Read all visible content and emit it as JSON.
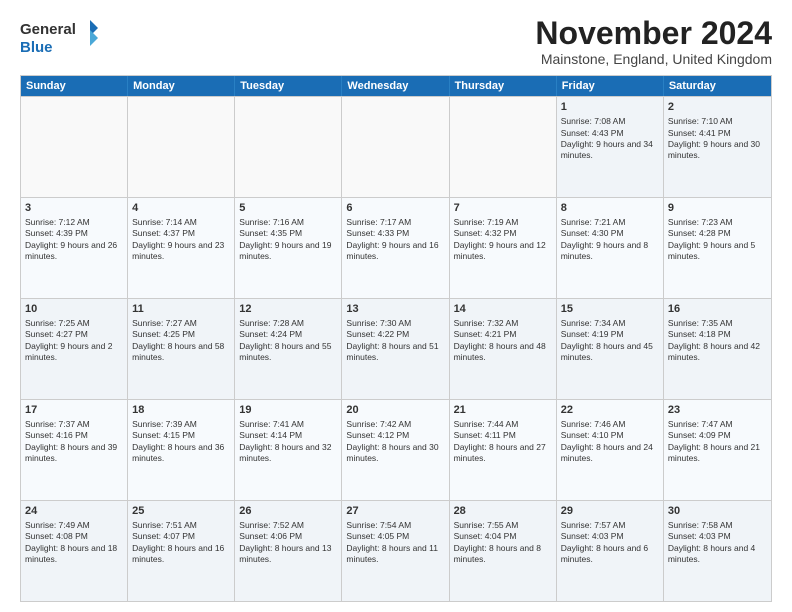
{
  "logo": {
    "line1": "General",
    "line2": "Blue"
  },
  "title": "November 2024",
  "subtitle": "Mainstone, England, United Kingdom",
  "days": [
    "Sunday",
    "Monday",
    "Tuesday",
    "Wednesday",
    "Thursday",
    "Friday",
    "Saturday"
  ],
  "rows": [
    [
      {
        "day": "",
        "empty": true
      },
      {
        "day": "",
        "empty": true
      },
      {
        "day": "",
        "empty": true
      },
      {
        "day": "",
        "empty": true
      },
      {
        "day": "",
        "empty": true
      },
      {
        "day": "1",
        "sunrise": "Sunrise: 7:08 AM",
        "sunset": "Sunset: 4:43 PM",
        "daylight": "Daylight: 9 hours and 34 minutes."
      },
      {
        "day": "2",
        "sunrise": "Sunrise: 7:10 AM",
        "sunset": "Sunset: 4:41 PM",
        "daylight": "Daylight: 9 hours and 30 minutes."
      }
    ],
    [
      {
        "day": "3",
        "sunrise": "Sunrise: 7:12 AM",
        "sunset": "Sunset: 4:39 PM",
        "daylight": "Daylight: 9 hours and 26 minutes."
      },
      {
        "day": "4",
        "sunrise": "Sunrise: 7:14 AM",
        "sunset": "Sunset: 4:37 PM",
        "daylight": "Daylight: 9 hours and 23 minutes."
      },
      {
        "day": "5",
        "sunrise": "Sunrise: 7:16 AM",
        "sunset": "Sunset: 4:35 PM",
        "daylight": "Daylight: 9 hours and 19 minutes."
      },
      {
        "day": "6",
        "sunrise": "Sunrise: 7:17 AM",
        "sunset": "Sunset: 4:33 PM",
        "daylight": "Daylight: 9 hours and 16 minutes."
      },
      {
        "day": "7",
        "sunrise": "Sunrise: 7:19 AM",
        "sunset": "Sunset: 4:32 PM",
        "daylight": "Daylight: 9 hours and 12 minutes."
      },
      {
        "day": "8",
        "sunrise": "Sunrise: 7:21 AM",
        "sunset": "Sunset: 4:30 PM",
        "daylight": "Daylight: 9 hours and 8 minutes."
      },
      {
        "day": "9",
        "sunrise": "Sunrise: 7:23 AM",
        "sunset": "Sunset: 4:28 PM",
        "daylight": "Daylight: 9 hours and 5 minutes."
      }
    ],
    [
      {
        "day": "10",
        "sunrise": "Sunrise: 7:25 AM",
        "sunset": "Sunset: 4:27 PM",
        "daylight": "Daylight: 9 hours and 2 minutes."
      },
      {
        "day": "11",
        "sunrise": "Sunrise: 7:27 AM",
        "sunset": "Sunset: 4:25 PM",
        "daylight": "Daylight: 8 hours and 58 minutes."
      },
      {
        "day": "12",
        "sunrise": "Sunrise: 7:28 AM",
        "sunset": "Sunset: 4:24 PM",
        "daylight": "Daylight: 8 hours and 55 minutes."
      },
      {
        "day": "13",
        "sunrise": "Sunrise: 7:30 AM",
        "sunset": "Sunset: 4:22 PM",
        "daylight": "Daylight: 8 hours and 51 minutes."
      },
      {
        "day": "14",
        "sunrise": "Sunrise: 7:32 AM",
        "sunset": "Sunset: 4:21 PM",
        "daylight": "Daylight: 8 hours and 48 minutes."
      },
      {
        "day": "15",
        "sunrise": "Sunrise: 7:34 AM",
        "sunset": "Sunset: 4:19 PM",
        "daylight": "Daylight: 8 hours and 45 minutes."
      },
      {
        "day": "16",
        "sunrise": "Sunrise: 7:35 AM",
        "sunset": "Sunset: 4:18 PM",
        "daylight": "Daylight: 8 hours and 42 minutes."
      }
    ],
    [
      {
        "day": "17",
        "sunrise": "Sunrise: 7:37 AM",
        "sunset": "Sunset: 4:16 PM",
        "daylight": "Daylight: 8 hours and 39 minutes."
      },
      {
        "day": "18",
        "sunrise": "Sunrise: 7:39 AM",
        "sunset": "Sunset: 4:15 PM",
        "daylight": "Daylight: 8 hours and 36 minutes."
      },
      {
        "day": "19",
        "sunrise": "Sunrise: 7:41 AM",
        "sunset": "Sunset: 4:14 PM",
        "daylight": "Daylight: 8 hours and 32 minutes."
      },
      {
        "day": "20",
        "sunrise": "Sunrise: 7:42 AM",
        "sunset": "Sunset: 4:12 PM",
        "daylight": "Daylight: 8 hours and 30 minutes."
      },
      {
        "day": "21",
        "sunrise": "Sunrise: 7:44 AM",
        "sunset": "Sunset: 4:11 PM",
        "daylight": "Daylight: 8 hours and 27 minutes."
      },
      {
        "day": "22",
        "sunrise": "Sunrise: 7:46 AM",
        "sunset": "Sunset: 4:10 PM",
        "daylight": "Daylight: 8 hours and 24 minutes."
      },
      {
        "day": "23",
        "sunrise": "Sunrise: 7:47 AM",
        "sunset": "Sunset: 4:09 PM",
        "daylight": "Daylight: 8 hours and 21 minutes."
      }
    ],
    [
      {
        "day": "24",
        "sunrise": "Sunrise: 7:49 AM",
        "sunset": "Sunset: 4:08 PM",
        "daylight": "Daylight: 8 hours and 18 minutes."
      },
      {
        "day": "25",
        "sunrise": "Sunrise: 7:51 AM",
        "sunset": "Sunset: 4:07 PM",
        "daylight": "Daylight: 8 hours and 16 minutes."
      },
      {
        "day": "26",
        "sunrise": "Sunrise: 7:52 AM",
        "sunset": "Sunset: 4:06 PM",
        "daylight": "Daylight: 8 hours and 13 minutes."
      },
      {
        "day": "27",
        "sunrise": "Sunrise: 7:54 AM",
        "sunset": "Sunset: 4:05 PM",
        "daylight": "Daylight: 8 hours and 11 minutes."
      },
      {
        "day": "28",
        "sunrise": "Sunrise: 7:55 AM",
        "sunset": "Sunset: 4:04 PM",
        "daylight": "Daylight: 8 hours and 8 minutes."
      },
      {
        "day": "29",
        "sunrise": "Sunrise: 7:57 AM",
        "sunset": "Sunset: 4:03 PM",
        "daylight": "Daylight: 8 hours and 6 minutes."
      },
      {
        "day": "30",
        "sunrise": "Sunrise: 7:58 AM",
        "sunset": "Sunset: 4:03 PM",
        "daylight": "Daylight: 8 hours and 4 minutes."
      }
    ]
  ]
}
